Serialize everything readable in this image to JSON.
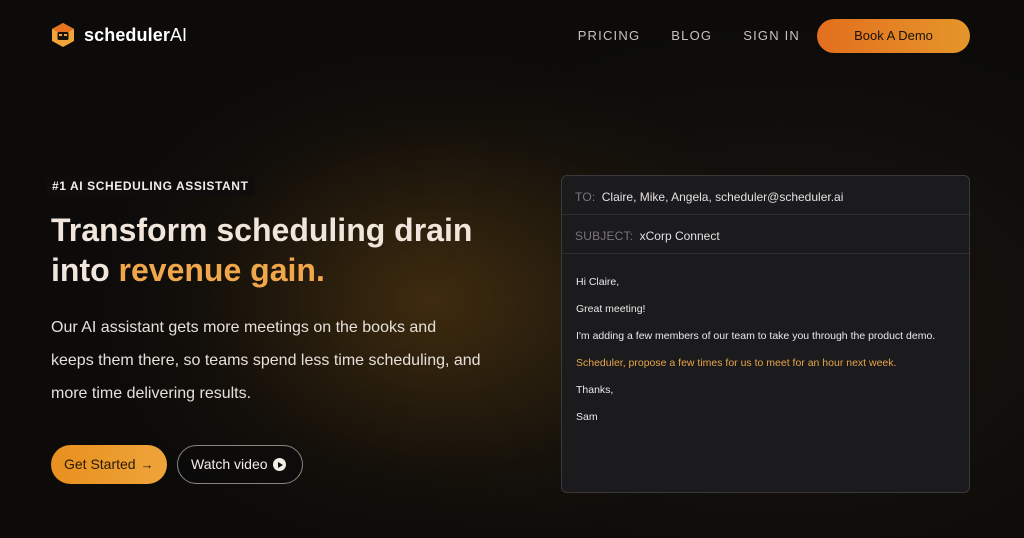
{
  "brand": {
    "name_bold": "scheduler",
    "name_light": "AI"
  },
  "nav": {
    "links": [
      "PRICING",
      "BLOG",
      "SIGN IN"
    ],
    "cta": "Book A Demo"
  },
  "hero": {
    "eyebrow": "#1 AI SCHEDULING ASSISTANT",
    "headline_line1": "Transform scheduling drain",
    "headline_line2_plain": "into ",
    "headline_line2_accent": "revenue gain.",
    "subtext": "Our AI assistant gets more meetings on the books and keeps them there, so teams spend less time scheduling, and more time delivering results.",
    "primary_button": "Get Started",
    "secondary_button": "Watch video"
  },
  "email": {
    "to_label": "TO:",
    "to_value": "Claire, Mike, Angela, scheduler@scheduler.ai",
    "subject_label": "SUBJECT:",
    "subject_value": "xCorp Connect",
    "greeting": "Hi Claire,",
    "line1": "Great meeting!",
    "line2": "I'm adding a few members of our team to take you through the product demo.",
    "line3": "Scheduler, propose a few times for us to meet for an hour next week.",
    "signoff": "Thanks,",
    "signature": "Sam"
  },
  "icons": {
    "logo": "scheduler-logo-icon",
    "arrow": "arrow-right-icon",
    "play": "play-circle-icon"
  },
  "colors": {
    "accent": "#f0a64a",
    "cta_gradient_start": "#e36f1e",
    "cta_gradient_end": "#e4962a",
    "background": "#0c0b0a",
    "card": "#1b1a1c"
  }
}
